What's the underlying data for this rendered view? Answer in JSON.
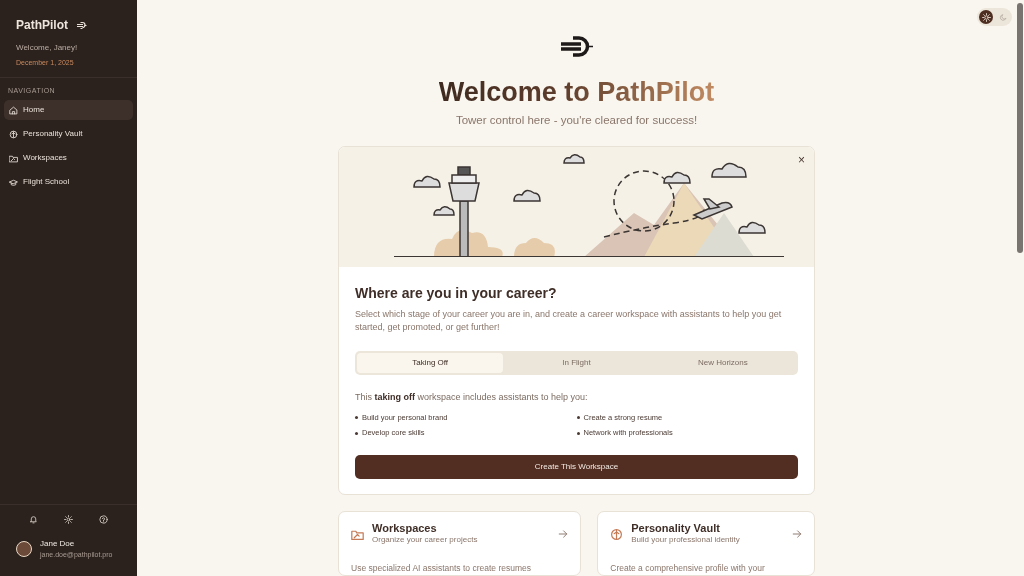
{
  "sidebar": {
    "brand": "PathPilot",
    "welcome": "Welcome, Janey!",
    "date": "December 1, 2025",
    "section_label": "NAVIGATION",
    "items": [
      {
        "label": "Home",
        "kind": "home",
        "selected": true
      },
      {
        "label": "Personality Vault",
        "kind": "brain",
        "selected": false
      },
      {
        "label": "Workspaces",
        "kind": "folder",
        "selected": false
      },
      {
        "label": "Flight School",
        "kind": "cap",
        "selected": false
      }
    ],
    "footer_icons": [
      {
        "kind": "bell"
      },
      {
        "kind": "gear"
      },
      {
        "kind": "help"
      }
    ],
    "user": {
      "name": "Jane Doe",
      "email": "jane.doe@pathpilot.pro"
    }
  },
  "theme_toggle": [
    {
      "kind": "light",
      "selected": true
    },
    {
      "kind": "dark",
      "selected": false
    }
  ],
  "hero": {
    "title": "Welcome to PathPilot",
    "subtitle": "Tower control here - you're cleared for success!"
  },
  "career_card": {
    "close": "×",
    "heading": "Where are you in your career?",
    "description": "Select which stage of your career you are in, and create a career workspace with assistants to help you get started, get promoted, or get further!",
    "tabs": [
      {
        "label": "Taking Off",
        "selected": true
      },
      {
        "label": "In Flight",
        "selected": false
      },
      {
        "label": "New Horizons",
        "selected": false
      }
    ],
    "intro": "This **taking off** workspace includes assistants to help you:",
    "bullets": [
      "Build your personal brand",
      "Create a strong resume",
      "Develop core skills",
      "Network with professionals"
    ],
    "button": "Create This Workspace"
  },
  "feature_cards": [
    {
      "kind": "folder",
      "title": "Workspaces",
      "subtitle": "Organize your career projects",
      "text": "Use specialized AI assistants to create resumes"
    },
    {
      "kind": "brain",
      "title": "Personality Vault",
      "subtitle": "Build your professional identity",
      "text": "Create a comprehensive profile with your"
    }
  ]
}
